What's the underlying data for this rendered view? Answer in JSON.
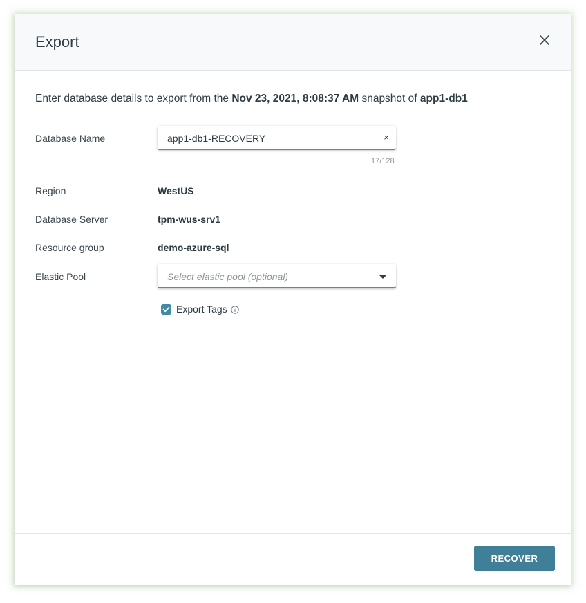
{
  "dialog": {
    "title": "Export",
    "intro": {
      "prefix": "Enter database details to export from the ",
      "snapshot_time": "Nov 23, 2021, 8:08:37 AM",
      "middle": " snapshot of ",
      "source": "app1-db1"
    }
  },
  "form": {
    "database_name": {
      "label": "Database Name",
      "value": "app1-db1-RECOVERY",
      "counter": "17/128",
      "clear_glyph": "×"
    },
    "region": {
      "label": "Region",
      "value": "WestUS"
    },
    "database_server": {
      "label": "Database Server",
      "value": "tpm-wus-srv1"
    },
    "resource_group": {
      "label": "Resource group",
      "value": "demo-azure-sql"
    },
    "elastic_pool": {
      "label": "Elastic Pool",
      "placeholder": "Select elastic pool (optional)",
      "value": ""
    },
    "export_tags": {
      "label": "Export Tags",
      "checked": true
    }
  },
  "footer": {
    "recover_label": "RECOVER"
  },
  "colors": {
    "accent": "#3f7f98",
    "checkbox": "#3f8aa6",
    "header_bg": "#f7f9fb",
    "text": "#2b3a42"
  },
  "icons": {
    "close": "close-icon",
    "clear": "clear-icon",
    "dropdown": "chevron-down-icon",
    "checkbox": "check-icon",
    "info": "info-icon"
  }
}
